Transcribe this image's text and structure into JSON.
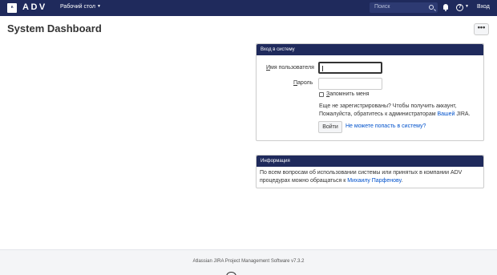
{
  "header": {
    "logo_glyph": "ᴿ",
    "brand": "ADV",
    "dashboard_menu": "Рабочий стол",
    "search_placeholder": "Поиск",
    "login_link": "Вход"
  },
  "page": {
    "title": "System Dashboard",
    "more_button": "•••"
  },
  "login_panel": {
    "title": "Вход в систему",
    "username_label_prefix": "И",
    "username_label_rest": "мя пользователя",
    "password_label_prefix": "П",
    "password_label_rest": "ароль",
    "username_value": "",
    "password_value": "",
    "remember_prefix": "З",
    "remember_rest": "апомнить меня",
    "signup_line1": "Еще не зарегистрированы? Чтобы получить аккаунт,",
    "signup_line2_prefix": "Пожалуйста, обратитесь к администраторам ",
    "signup_link": "Вашей",
    "signup_line2_suffix": " JIRA.",
    "login_button": "Войти",
    "forgot_link": "Не можете попасть в систему?"
  },
  "info_panel": {
    "title": "Информация",
    "text_line1": "По всем вопросам об использовании системы или принятых в компании ADV",
    "text_line2_prefix": "процедурах можно обращаться к ",
    "contact_link": "Михаилу Парфенову",
    "text_line2_suffix": "."
  },
  "footer": {
    "text": "Atlassian JIRA Project Management Software v7.3.2"
  },
  "colors": {
    "nav_bg": "#1f2a5c",
    "link": "#0052cc",
    "footer_bg": "#f4f5f7"
  }
}
